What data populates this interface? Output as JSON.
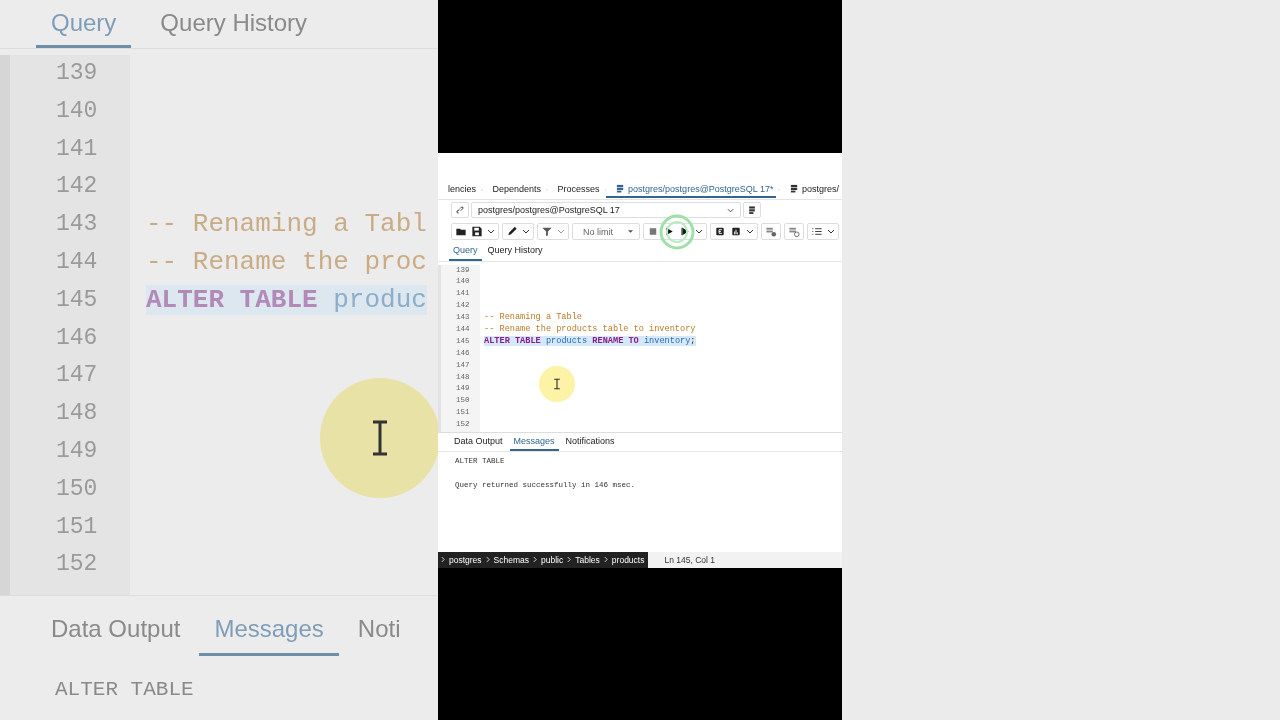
{
  "backdrop": {
    "tabs": [
      {
        "label": "Query",
        "selected": true
      },
      {
        "label": "Query History",
        "selected": false
      }
    ],
    "lines": [
      {
        "number": "139"
      },
      {
        "number": "140"
      },
      {
        "number": "141"
      },
      {
        "number": "142"
      },
      {
        "number": "143",
        "selected": false,
        "tokens": [
          {
            "kind": "comment",
            "text": "-- Renaming a Tabl"
          }
        ]
      },
      {
        "number": "144",
        "selected": false,
        "tokens": [
          {
            "kind": "comment",
            "text": "-- Rename the proc"
          }
        ]
      },
      {
        "number": "145",
        "selected": true,
        "tokens": [
          {
            "kind": "keyword",
            "text": "ALTER TABLE"
          },
          {
            "kind": "identifier",
            "text": "produc"
          }
        ]
      },
      {
        "number": "146"
      },
      {
        "number": "147"
      },
      {
        "number": "148"
      },
      {
        "number": "149"
      },
      {
        "number": "150"
      },
      {
        "number": "151"
      },
      {
        "number": "152"
      }
    ],
    "result_tabs": [
      {
        "label": "Data Output",
        "selected": false
      },
      {
        "label": "Messages",
        "selected": true
      },
      {
        "label": "Noti",
        "selected": false
      }
    ],
    "message": "ALTER TABLE"
  },
  "document_tabs": [
    {
      "label": "lencies",
      "selected": false,
      "icon": false,
      "closable": true
    },
    {
      "label": "Dependents",
      "selected": false,
      "icon": false,
      "closable": true
    },
    {
      "label": "Processes",
      "selected": false,
      "icon": false,
      "closable": true
    },
    {
      "label": "postgres/postgres@PostgreSQL 17*",
      "selected": true,
      "icon": true,
      "closable": true
    },
    {
      "label": "postgres/",
      "selected": false,
      "icon": true,
      "closable": false
    }
  ],
  "connection": {
    "value": "postgres/postgres@PostgreSQL 17"
  },
  "toolbar": {
    "limit": "No limit"
  },
  "editor_tabs": [
    {
      "label": "Query",
      "selected": true
    },
    {
      "label": "Query History",
      "selected": false
    }
  ],
  "editor": {
    "lines": [
      {
        "number": "139"
      },
      {
        "number": "140"
      },
      {
        "number": "141"
      },
      {
        "number": "142"
      },
      {
        "number": "143",
        "selected": false,
        "tokens": [
          {
            "kind": "comment",
            "text": "-- Renaming a Table"
          }
        ]
      },
      {
        "number": "144",
        "selected": false,
        "tokens": [
          {
            "kind": "comment",
            "text": "-- Rename the products table to inventory"
          }
        ]
      },
      {
        "number": "145",
        "selected": true,
        "tokens": [
          {
            "kind": "keyword",
            "text": "ALTER TABLE"
          },
          {
            "kind": "identifier",
            "text": "products"
          },
          {
            "kind": "keyword",
            "text": "RENAME TO"
          },
          {
            "kind": "identifier",
            "text": "inventory"
          },
          {
            "kind": "punct",
            "text": ";"
          }
        ]
      },
      {
        "number": "146"
      },
      {
        "number": "147"
      },
      {
        "number": "148"
      },
      {
        "number": "149"
      },
      {
        "number": "150"
      },
      {
        "number": "151"
      },
      {
        "number": "152"
      }
    ]
  },
  "result_tabs": [
    {
      "label": "Data Output",
      "selected": false
    },
    {
      "label": "Messages",
      "selected": true
    },
    {
      "label": "Notifications",
      "selected": false
    }
  ],
  "messages": [
    "ALTER TABLE",
    "Query returned successfully in 146 msec."
  ],
  "status_bar": {
    "breadcrumb": [
      "postgres",
      "Schemas",
      "public",
      "Tables",
      "products"
    ],
    "position": "Ln 145, Col 1"
  }
}
